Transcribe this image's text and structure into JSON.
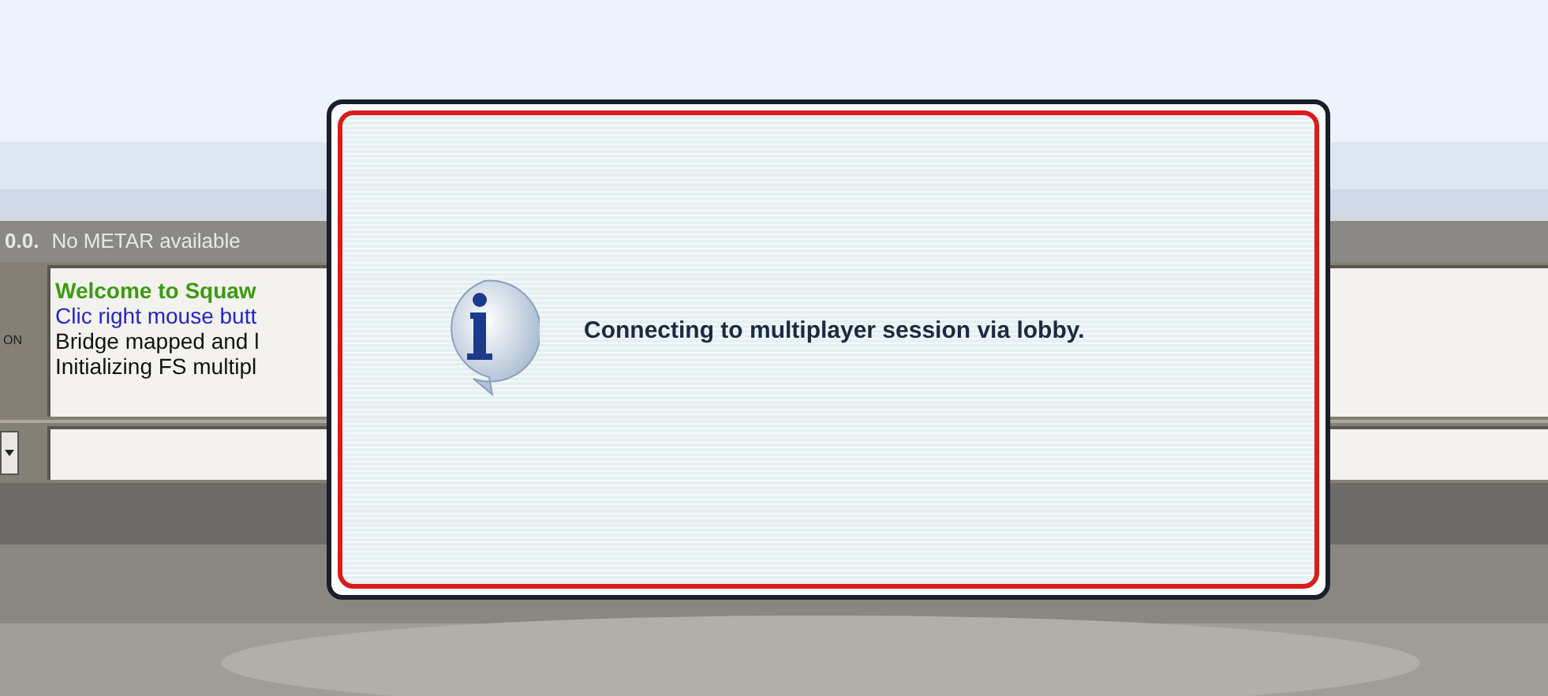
{
  "status_bar": {
    "version": "0.0.",
    "message": "No METAR available"
  },
  "side_label": "ON",
  "log": [
    {
      "text": "Welcome to Squaw",
      "kind": "welcome"
    },
    {
      "text": "Clic right mouse butt",
      "kind": "hint"
    },
    {
      "text": "Bridge mapped and l",
      "kind": "info"
    },
    {
      "text": "Initializing FS multipl",
      "kind": "info"
    }
  ],
  "dialog": {
    "message": "Connecting to multiplayer session via lobby."
  }
}
